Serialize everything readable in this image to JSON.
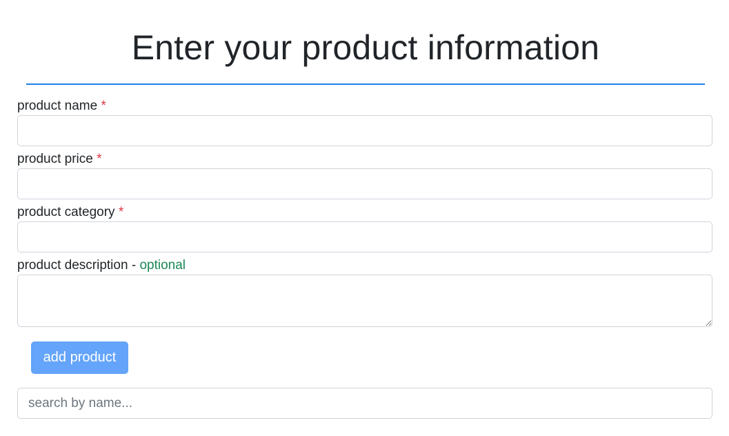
{
  "header": {
    "title": "Enter your product information"
  },
  "form": {
    "name_field": {
      "label": "product name",
      "required_mark": "*",
      "value": ""
    },
    "price_field": {
      "label": "product price",
      "required_mark": "*",
      "value": ""
    },
    "category_field": {
      "label": "product category",
      "required_mark": "*",
      "value": ""
    },
    "description_field": {
      "label": "product description",
      "separator": "-",
      "optional_text": "optional",
      "value": ""
    },
    "add_button_label": "add product"
  },
  "search": {
    "placeholder": "search by name...",
    "value": ""
  },
  "colors": {
    "accent_rule": "#1e7fe6",
    "required": "#dc3545",
    "optional": "#198754",
    "button_bg": "#64a4fa",
    "button_text": "#ffffff",
    "input_border": "#ced4da"
  }
}
